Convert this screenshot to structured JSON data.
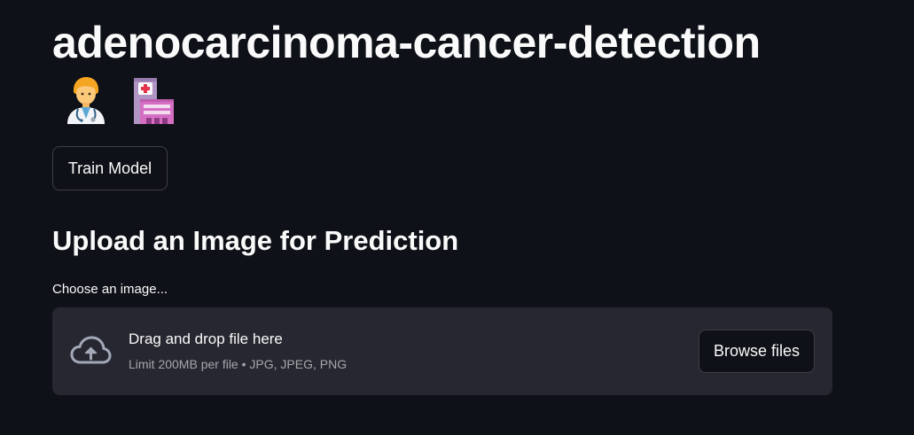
{
  "header": {
    "title": "adenocarcinoma-cancer-detection",
    "emojis": [
      "health-worker-emoji",
      "hospital-emoji"
    ]
  },
  "actions": {
    "train_label": "Train Model"
  },
  "upload": {
    "heading": "Upload an Image for Prediction",
    "label": "Choose an image...",
    "drop_text": "Drag and drop file here",
    "limit_text": "Limit 200MB per file • JPG, JPEG, PNG",
    "browse_label": "Browse files",
    "icon": "cloud-upload-icon"
  },
  "colors": {
    "background": "#0e1117",
    "dropzone": "#262730",
    "text": "#fafafa"
  }
}
